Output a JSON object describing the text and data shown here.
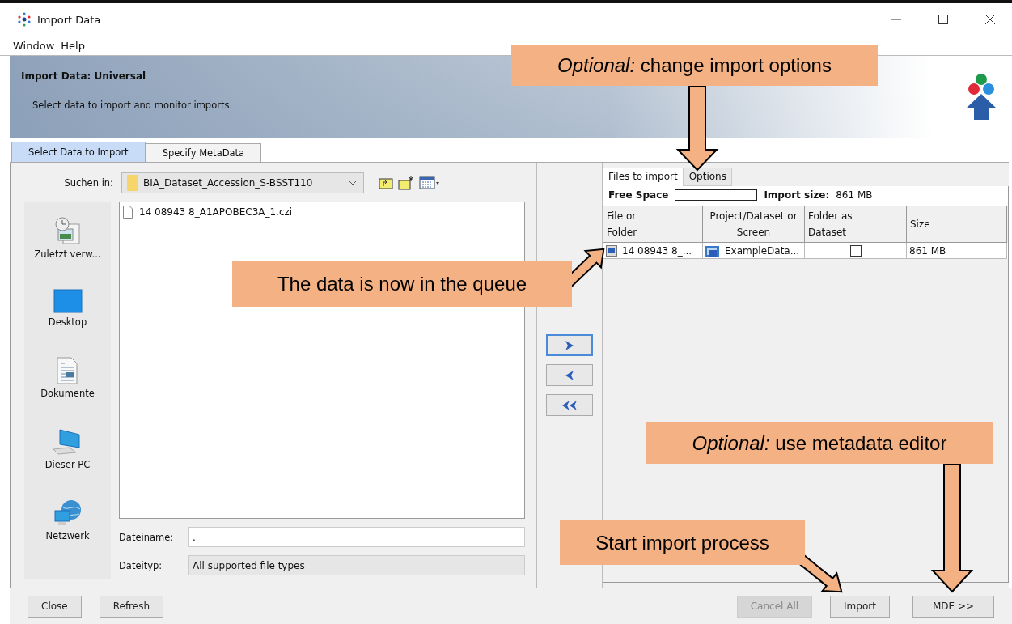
{
  "window": {
    "title": "Import Data"
  },
  "menu": [
    "Window",
    "Help"
  ],
  "banner": {
    "title": "Import Data: Universal",
    "subtitle": "Select data to import and monitor imports."
  },
  "tabs": [
    {
      "label": "Select Data to Import",
      "selected": true
    },
    {
      "label": "Specify MetaData",
      "selected": false
    }
  ],
  "chooser": {
    "look_in_label": "Suchen in:",
    "folder": "BIA_Dataset_Accession_S-BSST110",
    "places": [
      {
        "label": "Zuletzt verw...",
        "kind": "recent"
      },
      {
        "label": "Desktop",
        "kind": "desktop"
      },
      {
        "label": "Dokumente",
        "kind": "documents"
      },
      {
        "label": "Dieser PC",
        "kind": "computer"
      },
      {
        "label": "Netzwerk",
        "kind": "network"
      }
    ],
    "files": [
      "14 08943 8_A1APOBEC3A_1.czi"
    ],
    "file_name_label": "Dateiname:",
    "file_name": ".",
    "file_type_label": "Dateityp:",
    "file_type": "All supported file types"
  },
  "transfer_buttons": [
    {
      "kind": "add"
    },
    {
      "kind": "remove"
    },
    {
      "kind": "remove_all"
    }
  ],
  "queue": {
    "tabs": [
      {
        "label": "Files to import",
        "selected": true
      },
      {
        "label": "Options",
        "selected": false
      }
    ],
    "free_space_label": "Free Space",
    "free_space": {
      "level": 0
    },
    "import_size_label": "Import size:",
    "import_size": "861 MB",
    "columns": [
      "File or Folder",
      "Project/Dataset or Screen",
      "Folder as Dataset",
      "Size"
    ],
    "rows": [
      {
        "file": "14 08943 8_...",
        "target": "ExampleData...",
        "folder_as_dataset": false,
        "size": "861 MB"
      }
    ]
  },
  "buttons_left": [
    "Close",
    "Refresh"
  ],
  "buttons_right": [
    {
      "label": "Cancel All",
      "disabled": true
    },
    {
      "label": "Import",
      "disabled": false
    },
    {
      "label": "MDE >>",
      "disabled": false
    }
  ],
  "callouts": [
    "*Optional:* change import options",
    "The data is now in the queue",
    "*Optional:* use metadata editor",
    "Start import process"
  ]
}
